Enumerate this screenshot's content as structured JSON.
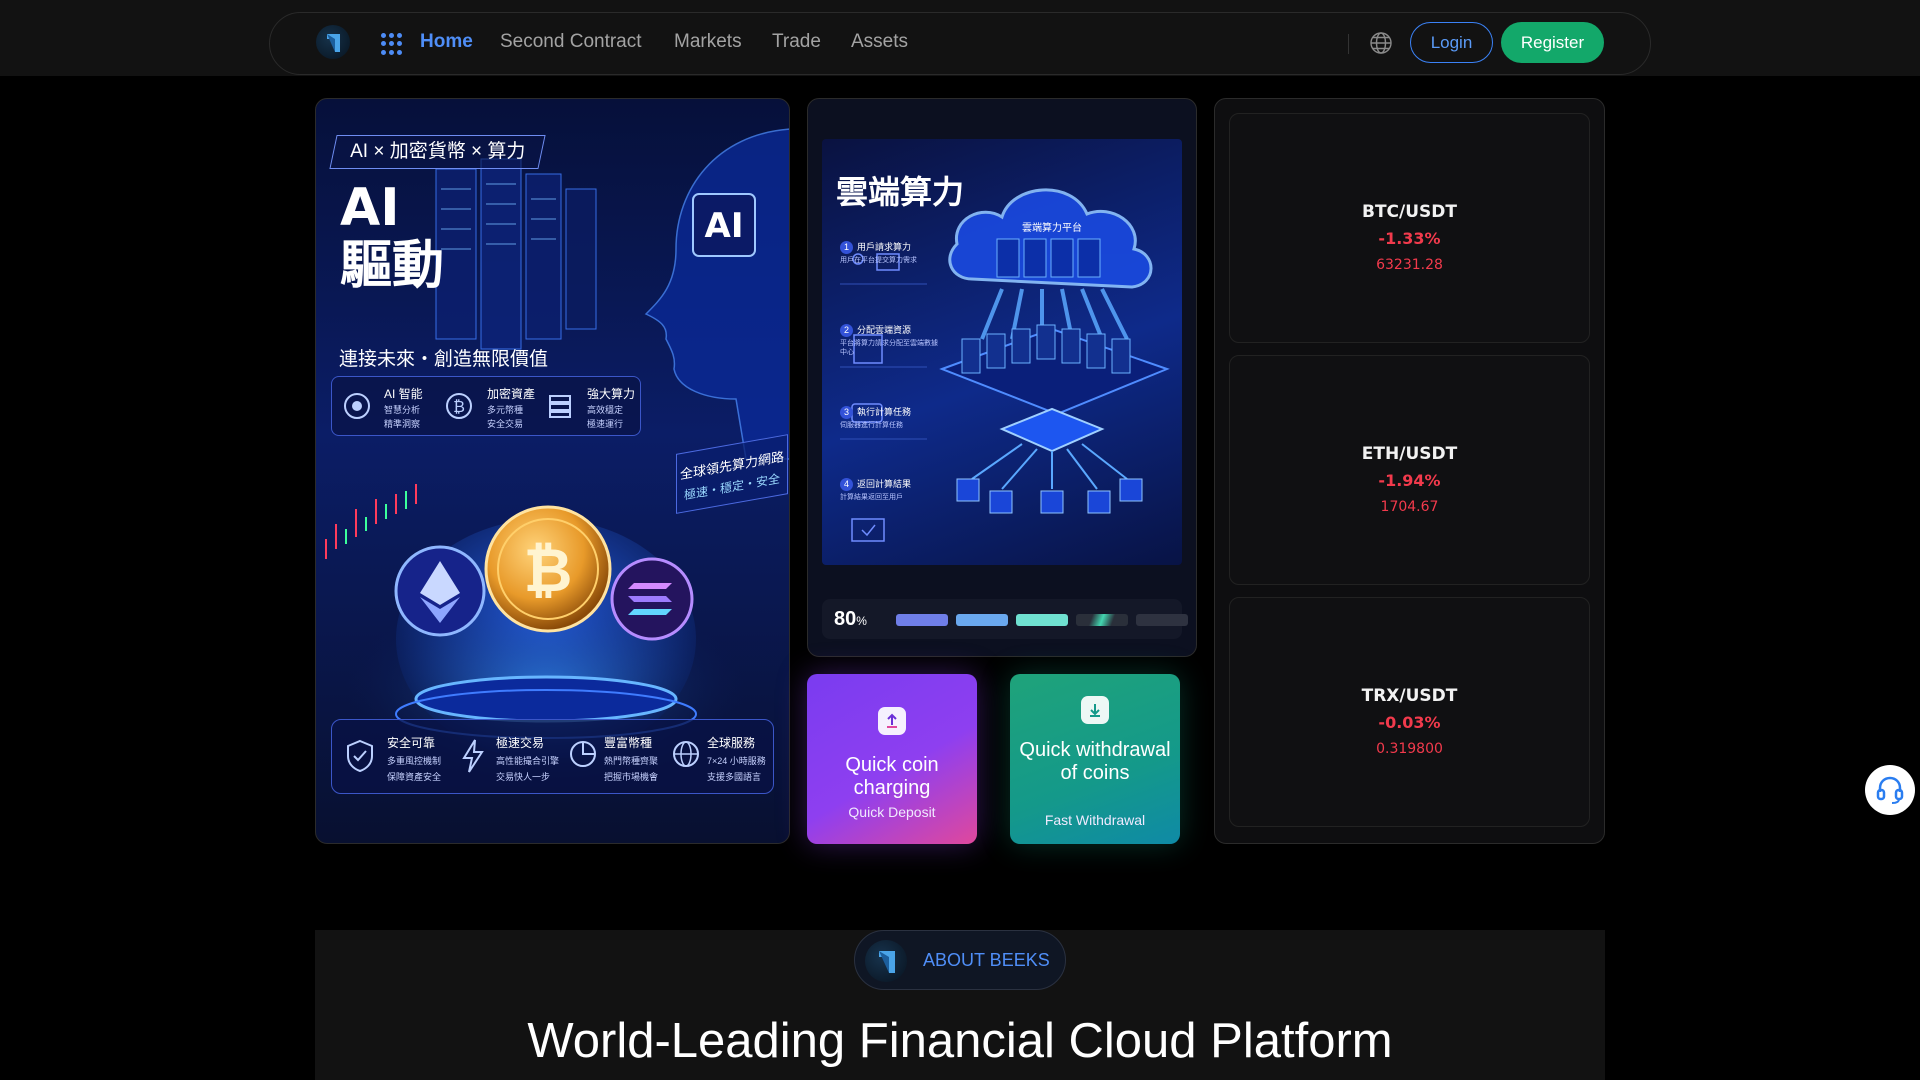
{
  "nav": {
    "items": [
      {
        "label": "Home",
        "active": true
      },
      {
        "label": "Second Contract",
        "active": false
      },
      {
        "label": "Markets",
        "active": false
      },
      {
        "label": "Trade",
        "active": false
      },
      {
        "label": "Assets",
        "active": false
      }
    ],
    "login_label": "Login",
    "register_label": "Register"
  },
  "hero_left": {
    "tag": "AI × 加密貨幣 × 算力",
    "big_line1": "AI",
    "big_line2": "驅動",
    "badge": "AI",
    "subtitle": "連接未來・創造無限價值",
    "features": [
      {
        "title": "AI 智能",
        "desc1": "智慧分析",
        "desc2": "精準洞察"
      },
      {
        "title": "加密資產",
        "desc1": "多元幣種",
        "desc2": "安全交易"
      },
      {
        "title": "強大算力",
        "desc1": "高效穩定",
        "desc2": "極速運行"
      }
    ],
    "network_line1": "全球領先算力網路",
    "network_line2": "極速・穩定・安全",
    "bottom_features": [
      {
        "title": "安全可靠",
        "desc1": "多重風控機制",
        "desc2": "保障資產安全"
      },
      {
        "title": "極速交易",
        "desc1": "高性能撮合引擎",
        "desc2": "交易快人一步"
      },
      {
        "title": "豐富幣種",
        "desc1": "熱門幣種齊聚",
        "desc2": "把握市場機會"
      },
      {
        "title": "全球服務",
        "desc1": "7×24 小時服務",
        "desc2": "支援多國語言"
      }
    ]
  },
  "hero_mid": {
    "title": "雲端算力",
    "platform_label": "雲端算力平台",
    "steps": [
      {
        "num": "1",
        "title": "用戶請求算力",
        "desc": "用戶在平台提交算力需求"
      },
      {
        "num": "2",
        "title": "分配雲端資源",
        "desc": "平台將算力請求分配至雲端數據中心"
      },
      {
        "num": "3",
        "title": "執行計算任務",
        "desc": "伺服器進行計算任務"
      },
      {
        "num": "4",
        "title": "返回計算結果",
        "desc": "計算結果返回至用戶"
      }
    ],
    "progress_value": "80",
    "progress_unit": "%",
    "progress_fraction": 0.8
  },
  "quick": {
    "deposit_title": "Quick coin charging",
    "deposit_sub": "Quick Deposit",
    "withdraw_title": "Quick withdrawal of coins",
    "withdraw_sub": "Fast Withdrawal"
  },
  "tickers": [
    {
      "pair": "BTC/USDT",
      "change": "-1.33%",
      "price": "63231.28"
    },
    {
      "pair": "ETH/USDT",
      "change": "-1.94%",
      "price": "1704.67"
    },
    {
      "pair": "TRX/USDT",
      "change": "-0.03%",
      "price": "0.319800"
    }
  ],
  "about": {
    "label": "ABOUT BEEKS",
    "title": "World-Leading Financial Cloud Platform"
  },
  "colors": {
    "accent": "#4f8ef7",
    "register": "#13a86a",
    "negative": "#f23a4c"
  },
  "icons": [
    "logo",
    "apps-grid-icon",
    "globe-icon",
    "upload-icon",
    "download-icon",
    "headset-icon"
  ]
}
